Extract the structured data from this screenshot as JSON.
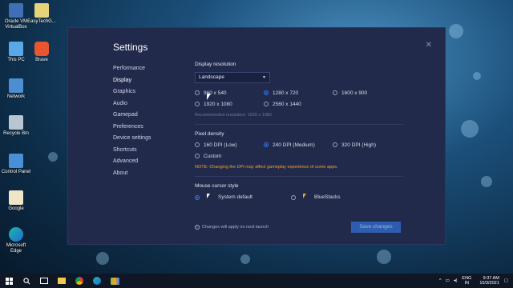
{
  "desktop": {
    "icons": [
      {
        "label": "Oracle VM VirtualBox",
        "icon": "virtualbox-icon"
      },
      {
        "label": "EasyTechG...",
        "icon": "file-icon"
      },
      {
        "label": "This PC",
        "icon": "computer-icon"
      },
      {
        "label": "Brave",
        "icon": "brave-icon"
      },
      {
        "label": "Network",
        "icon": "network-icon"
      },
      {
        "label": "Recycle Bin",
        "icon": "recycle-bin-icon"
      },
      {
        "label": "Control Panel",
        "icon": "control-panel-icon"
      },
      {
        "label": "Google",
        "icon": "file-icon"
      },
      {
        "label": "Microsoft Edge",
        "icon": "edge-icon"
      }
    ]
  },
  "settings": {
    "title": "Settings",
    "close_glyph": "✕",
    "nav": [
      {
        "label": "Performance"
      },
      {
        "label": "Display",
        "active": true
      },
      {
        "label": "Graphics"
      },
      {
        "label": "Audio"
      },
      {
        "label": "Gamepad"
      },
      {
        "label": "Preferences"
      },
      {
        "label": "Device settings"
      },
      {
        "label": "Shortcuts"
      },
      {
        "label": "Advanced"
      },
      {
        "label": "About"
      }
    ],
    "display_resolution": {
      "label": "Display resolution",
      "orientation": "Landscape",
      "options": [
        {
          "label": "960 x 540",
          "selected": false
        },
        {
          "label": "1280 x 720",
          "selected": true
        },
        {
          "label": "1600 x 900",
          "selected": false
        },
        {
          "label": "1920 x 1080",
          "selected": false
        },
        {
          "label": "2560 x 1440",
          "selected": false
        }
      ],
      "recommended": "Recommended resolution: 1920 x 1080"
    },
    "pixel_density": {
      "label": "Pixel density",
      "options": [
        {
          "label": "160 DPI (Low)",
          "selected": false
        },
        {
          "label": "240 DPI (Medium)",
          "selected": true
        },
        {
          "label": "320 DPI (High)",
          "selected": false
        },
        {
          "label": "Custom",
          "selected": false
        }
      ],
      "note": "NOTE: Changing the DPI may affect gameplay experience of some apps."
    },
    "mouse_cursor": {
      "label": "Mouse cursor style",
      "options": [
        {
          "label": "System default",
          "selected": true
        },
        {
          "label": "BlueStacks",
          "selected": false
        }
      ]
    },
    "footer_note": "Changes will apply on next launch",
    "save_label": "Save changes"
  },
  "taskbar": {
    "lang_top": "ENG",
    "lang_bottom": "IN",
    "time": "9:37 AM",
    "date": "10/3/2021"
  },
  "colors": {
    "panel": "#222a4b",
    "accent": "#3a7bf0",
    "save_button": "#2e5db0",
    "note": "#f0a030"
  }
}
